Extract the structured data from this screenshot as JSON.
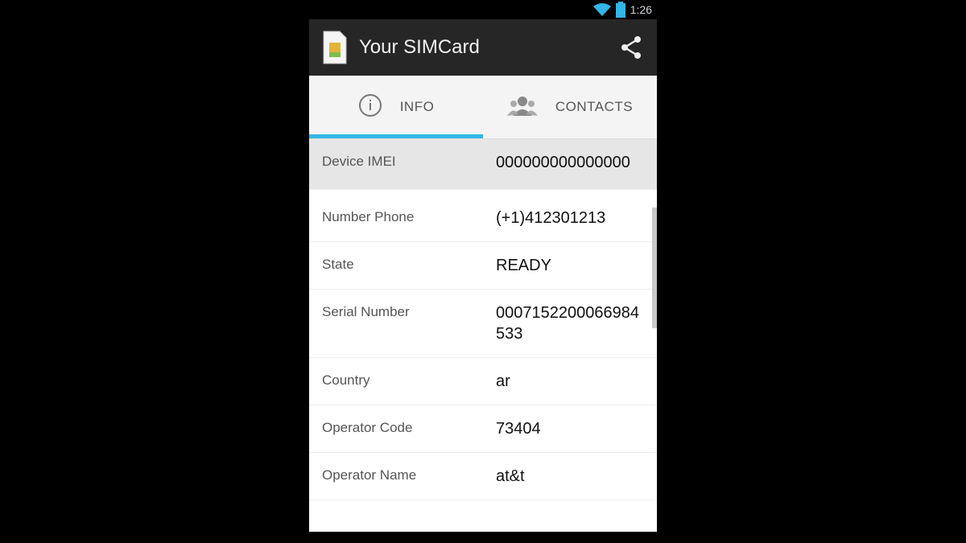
{
  "status": {
    "time": "1:26"
  },
  "app": {
    "title": "Your SIMCard"
  },
  "tabs": [
    {
      "label": "INFO",
      "active": true
    },
    {
      "label": "CONTACTS",
      "active": false
    }
  ],
  "rows": [
    {
      "label": "Device IMEI",
      "value": "000000000000000"
    },
    {
      "label": "Number Phone",
      "value": "(+1)412301213"
    },
    {
      "label": "State",
      "value": "READY"
    },
    {
      "label": "Serial Number",
      "value": "0007152200066984533"
    },
    {
      "label": "Country",
      "value": "ar"
    },
    {
      "label": "Operator Code",
      "value": "73404"
    },
    {
      "label": "Operator Name",
      "value": "at&t"
    }
  ],
  "colors": {
    "accent": "#33b5e5",
    "actionbar": "#262626"
  }
}
